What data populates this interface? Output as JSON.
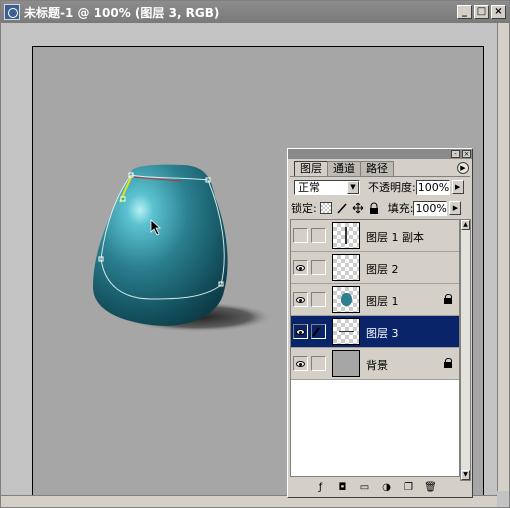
{
  "document": {
    "title": "未标题-1 @ 100% (图层 3, RGB)",
    "window_buttons": [
      "_",
      "□",
      "×"
    ]
  },
  "palette": {
    "tabs": [
      {
        "label": "图层",
        "active": true
      },
      {
        "label": "通道",
        "active": false
      },
      {
        "label": "路径",
        "active": false
      }
    ],
    "blend_mode": "正常",
    "opacity_label": "不透明度:",
    "opacity_value": "100%",
    "lock_label": "锁定:",
    "fill_label": "填充:",
    "fill_value": "100%",
    "layers": [
      {
        "name": "图层 1 副本",
        "visible": false,
        "selected": false,
        "locked": false,
        "thumb": "vertical-line"
      },
      {
        "name": "图层 2",
        "visible": true,
        "selected": false,
        "locked": false,
        "thumb": "empty"
      },
      {
        "name": "图层 1",
        "visible": true,
        "selected": false,
        "locked": true,
        "thumb": "blue-shape"
      },
      {
        "name": "图层 3",
        "visible": true,
        "selected": true,
        "locked": false,
        "thumb": "horizontal-line"
      },
      {
        "name": "背景",
        "visible": true,
        "selected": false,
        "locked": true,
        "thumb": "gray"
      }
    ],
    "footer_icons": [
      "layer-style-icon",
      "add-mask-icon",
      "new-set-icon",
      "adjustment-layer-icon",
      "new-layer-icon",
      "trash-icon"
    ]
  },
  "colors": {
    "shape_teal": "#2f7f8e",
    "canvas_bg": "#a6a6a6",
    "selection": "#0a246a"
  }
}
